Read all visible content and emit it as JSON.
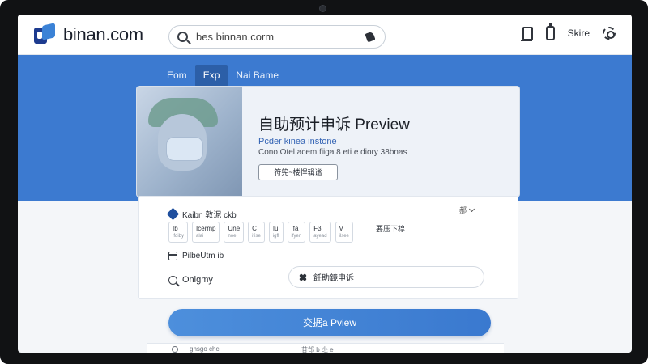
{
  "site": {
    "logo_text": "binan.com",
    "search_value": "bes binnan.corm"
  },
  "topnav": {
    "right_label": "Skire"
  },
  "tabs": [
    {
      "label": "Eom"
    },
    {
      "label": "Exp"
    },
    {
      "label": "Nai Bame"
    }
  ],
  "hero": {
    "title": "自助预计申诉 Preview",
    "subtitle": "Pcder kinea instone",
    "description": "Cono Otel acem fiiga 8 eti e diory 38bnas",
    "button_label": "符筅~楼悍辑谧"
  },
  "form": {
    "brand_text": "Kaibn 敦泥 ckb",
    "lang_select": "郝",
    "fields": [
      {
        "label": "Ib",
        "sub": "ifdiby"
      },
      {
        "label": "Icermp",
        "sub": "alai"
      },
      {
        "label": "Une",
        "sub": "noe"
      },
      {
        "label": "C",
        "sub": "ifise"
      },
      {
        "label": "Iu",
        "sub": "igfl"
      },
      {
        "label": "Ifa",
        "sub": "ifyen"
      },
      {
        "label": "F3",
        "sub": "ayead"
      },
      {
        "label": "V",
        "sub": "ilsee"
      }
    ],
    "fields_tail": "要压下椁",
    "date_label": "PilbeUtm ib",
    "query_label": "Onigmy",
    "pill_label": "飪助鏡申诉",
    "submit_label": "交据a Pview"
  },
  "bottom": {
    "text1": "ghsgo chc",
    "text2": "苷邙 b 尐 e"
  }
}
